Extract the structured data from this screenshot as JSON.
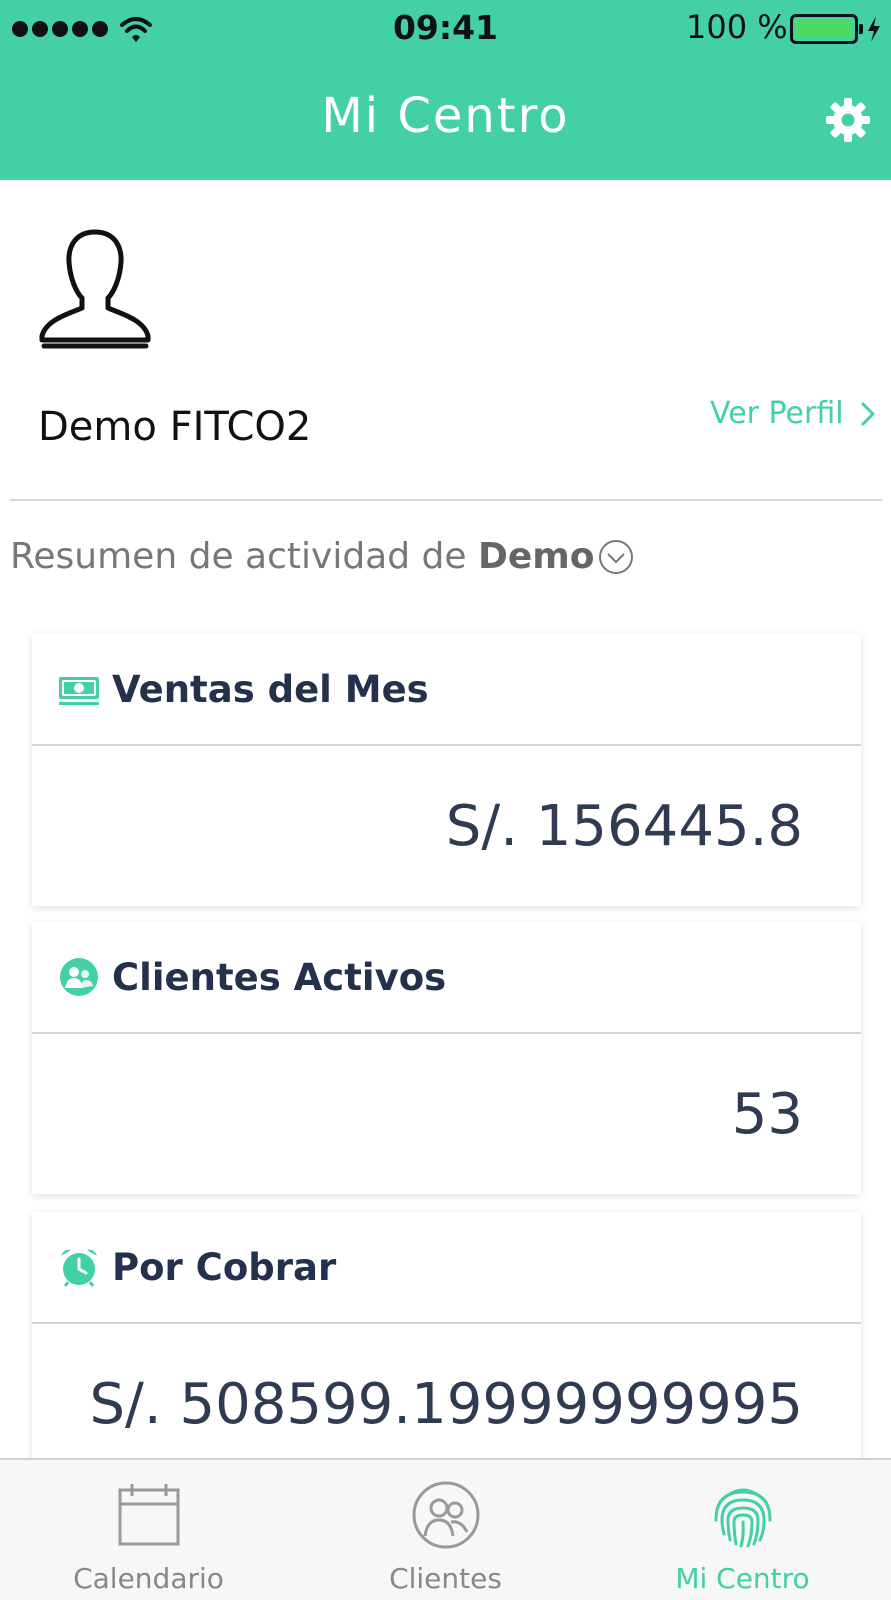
{
  "status_bar": {
    "time": "09:41",
    "battery": "100 %"
  },
  "nav": {
    "title": "Mi Centro",
    "settings_icon": "gear-icon"
  },
  "profile": {
    "name": "Demo FITCO2",
    "link_label": "Ver Perfil"
  },
  "summary": {
    "prefix": "Resumen de actividad de ",
    "selected": "Demo"
  },
  "cards": [
    {
      "title": "Ventas del Mes",
      "value": "S/. 156445.8",
      "icon": "money-icon"
    },
    {
      "title": "Clientes Activos",
      "value": "53",
      "icon": "clients-icon"
    },
    {
      "title": "Por Cobrar",
      "value": "S/. 508599.19999999995",
      "icon": "alarm-clock-icon"
    }
  ],
  "tabs": [
    {
      "label": "Calendario",
      "icon": "calendar-icon",
      "active": false
    },
    {
      "label": "Clientes",
      "icon": "clients-icon",
      "active": false
    },
    {
      "label": "Mi Centro",
      "icon": "fingerprint-icon",
      "active": true
    }
  ],
  "colors": {
    "accent": "#43D0A6",
    "card_title": "#23314d",
    "battery_fill": "#4CD964"
  }
}
